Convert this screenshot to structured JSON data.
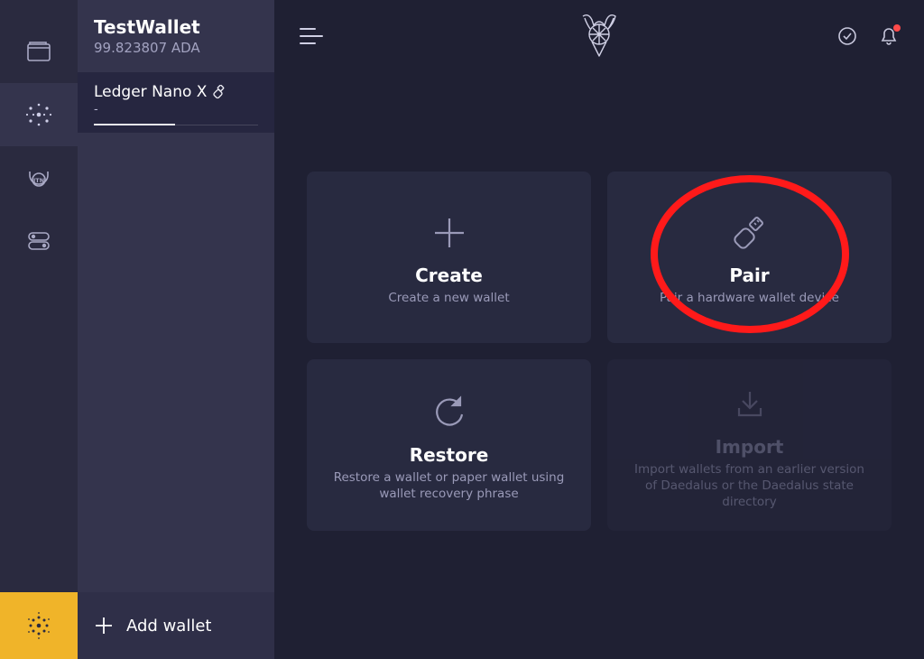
{
  "wallet": {
    "name": "TestWallet",
    "balance": "99.823807 ADA"
  },
  "sidebar": {
    "selected_wallet": {
      "name": "Ledger Nano X",
      "sub": "-"
    },
    "add_label": "Add wallet"
  },
  "tiles": {
    "create": {
      "title": "Create",
      "desc": "Create a new wallet"
    },
    "pair": {
      "title": "Pair",
      "desc": "Pair a hardware wallet device"
    },
    "restore": {
      "title": "Restore",
      "desc": "Restore a wallet or paper wallet using wallet recovery phrase"
    },
    "import": {
      "title": "Import",
      "desc": "Import wallets from an earlier version of Daedalus or the Daedalus state directory"
    }
  }
}
